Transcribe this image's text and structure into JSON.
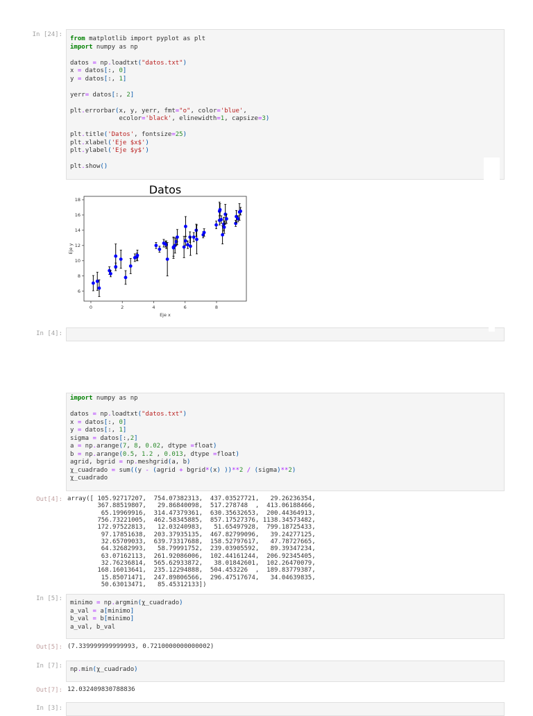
{
  "cells": [
    {
      "prompt": "In [24]:",
      "code": [
        "from matplotlib import pyplot as plt",
        "import numpy as np",
        "",
        "datos = np.loadtxt(\"datos.txt\")",
        "x = datos[:, 0]",
        "y = datos[:, 1]",
        "",
        "yerr= datos[:, 2]",
        "",
        "plt.errorbar(x, y, yerr, fmt=\"o\", color='blue',",
        "             ecolor='black', elinewidth=1, capsize=3)",
        "",
        "plt.title('Datos', fontsize=25)",
        "plt.xlabel('Eje $x$')",
        "plt.ylabel('Eje $y$')",
        "",
        "plt.show()"
      ]
    },
    {
      "prompt": "In [4]:",
      "code": []
    },
    {
      "prompt": "",
      "code": [
        "import numpy as np",
        "",
        "datos = np.loadtxt(\"datos.txt\")",
        "x = datos[:, 0]",
        "y = datos[:, 1]",
        "sigma = datos[:,2]",
        "a = np.arange(7, 8, 0.02, dtype =float)",
        "b = np.arange(0.5, 1.2 , 0.013, dtype =float)",
        "agrid, bgrid = np.meshgrid(a, b)",
        "χ_cuadrado = sum((y - (agrid + bgrid*(x) ))**2 / (sigma)**2)",
        "χ_cuadrado"
      ],
      "out_prompt": "Out[4]:",
      "output": [
        "array([ 105.92717207,  754.07382313,  437.03527721,   29.26236354,",
        "        367.88519807,   29.86840098,  517.278748  ,  413.06188466,",
        "         65.19969916,  314.47379361,  630.35632653,  200.44364913,",
        "        756.73221005,  462.58345885,  857.17527376, 1138.34573482,",
        "        172.97522813,   12.03240983,   51.65497928,  799.18725433,",
        "         97.17851638,  203.37935135,  467.82799096,   39.24277125,",
        "         32.65709033,  639.73317688,  158.52797617,   47.78727665,",
        "         64.32682993,   58.79991752,  239.03905592,   89.39347234,",
        "         63.07162113,  261.92086006,  102.44161244,  206.92345405,",
        "         32.76236814,  565.62933872,   38.01842601,  102.26470079,",
        "        168.16013641,  235.12294888,  504.453226  ,  189.83779387,",
        "         15.85071471,  247.89806566,  296.47517674,   34.04639835,",
        "         50.63013471,   85.45312133])"
      ]
    },
    {
      "prompt": "In [5]:",
      "code": [
        "minimo = np.argmin(χ_cuadrado)",
        "a_val = a[minimo]",
        "b_val = b[minimo]",
        "a_val, b_val"
      ],
      "out_prompt": "Out[5]:",
      "output": [
        "(7.339999999999993, 0.7210000000000002)"
      ]
    },
    {
      "prompt": "In [7]:",
      "code": [
        "np.min(χ_cuadrado)"
      ],
      "out_prompt": "Out[7]:",
      "output": [
        "12.032409830788836"
      ]
    },
    {
      "prompt": "In [3]:",
      "code": []
    }
  ],
  "chart_data": {
    "type": "scatter",
    "title": "Datos",
    "xlabel": "Eje x",
    "ylabel": "Eje y",
    "xlim": [
      -0.44,
      9.9
    ],
    "ylim": [
      4.7,
      18.45
    ],
    "xticks": [
      0,
      2,
      4,
      6,
      8
    ],
    "yticks": [
      6,
      8,
      10,
      12,
      14,
      16,
      18
    ],
    "marker_color": "#0000ff",
    "errorbar_color": "#000000",
    "x": [
      0.15,
      0.41,
      0.53,
      1.18,
      1.26,
      1.58,
      1.58,
      1.91,
      2.21,
      2.53,
      2.8,
      2.93,
      2.96,
      4.15,
      4.37,
      4.64,
      4.76,
      4.8,
      4.87,
      5.26,
      5.26,
      5.36,
      5.44,
      5.5,
      5.93,
      6.03,
      6.03,
      6.17,
      6.31,
      6.34,
      6.55,
      6.71,
      6.74,
      7.15,
      7.21,
      7.98,
      8.19,
      8.22,
      8.19,
      8.3,
      8.38,
      8.46,
      8.49,
      8.56,
      8.64,
      9.22,
      9.26,
      9.37,
      9.46,
      9.53
    ],
    "y": [
      7.06,
      7.3,
      6.4,
      8.7,
      8.3,
      10.6,
      9.2,
      10.2,
      7.8,
      9.3,
      10.4,
      10.5,
      10.7,
      12.0,
      11.5,
      12.3,
      12.2,
      12.1,
      10.2,
      11.8,
      11.7,
      12.0,
      12.5,
      13.1,
      11.8,
      14.5,
      12.6,
      12.1,
      13.1,
      11.9,
      13.1,
      14.0,
      12.8,
      13.4,
      13.7,
      14.7,
      16.5,
      16.7,
      15.3,
      15.4,
      13.4,
      14.8,
      14.4,
      16.1,
      15.5,
      14.9,
      15.8,
      15.5,
      16.4,
      16.5
    ],
    "yerr": [
      1.0,
      1.2,
      1.1,
      0.5,
      0.4,
      1.6,
      0.5,
      1.2,
      0.9,
      1.0,
      0.5,
      0.5,
      0.7,
      0.4,
      0.4,
      0.5,
      0.4,
      0.5,
      2.2,
      1.2,
      1.4,
      1.0,
      0.5,
      1.0,
      1.4,
      1.3,
      0.6,
      0.5,
      0.7,
      1.2,
      0.6,
      0.8,
      1.9,
      0.4,
      0.5,
      0.5,
      1.2,
      0.8,
      0.6,
      0.5,
      1.2,
      0.9,
      0.8,
      1.3,
      0.6,
      0.4,
      0.8,
      0.4,
      1.1,
      0.5
    ]
  }
}
